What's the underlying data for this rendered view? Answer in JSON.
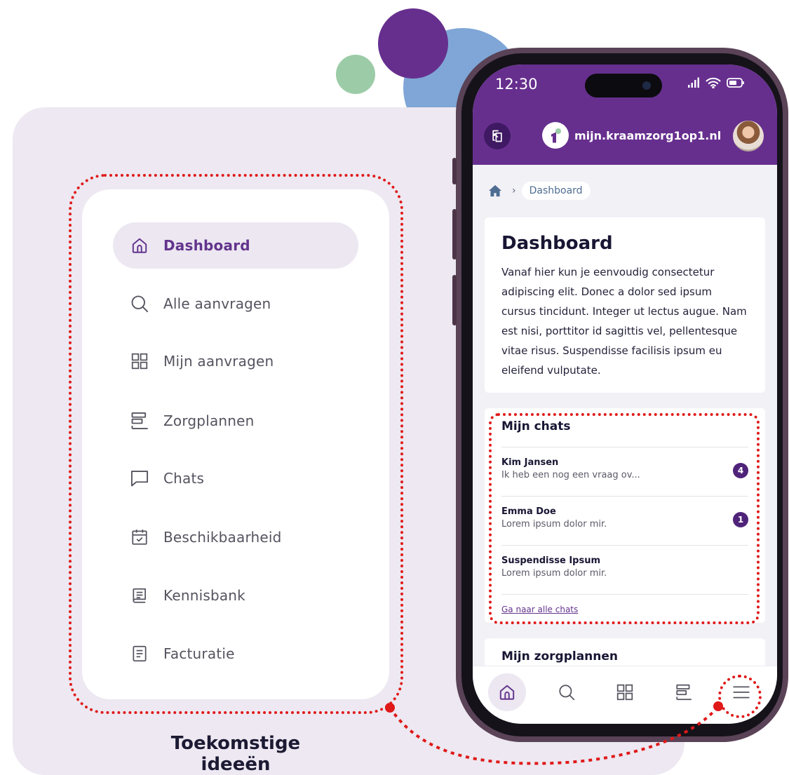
{
  "nav": {
    "items": [
      {
        "label": "Dashboard",
        "icon": "home-icon",
        "active": true
      },
      {
        "label": "Alle aanvragen",
        "icon": "search-icon",
        "active": false
      },
      {
        "label": "Mijn aanvragen",
        "icon": "grid-icon",
        "active": false
      },
      {
        "label": "Zorgplannen",
        "icon": "list-icon",
        "active": false
      },
      {
        "label": "Chats",
        "icon": "chat-icon",
        "active": false
      },
      {
        "label": "Beschikbaarheid",
        "icon": "calendar-check-icon",
        "active": false
      },
      {
        "label": "Kennisbank",
        "icon": "book-icon",
        "active": false
      },
      {
        "label": "Facturatie",
        "icon": "document-icon",
        "active": false
      }
    ]
  },
  "caption": "Toekomstige ideeën",
  "phone": {
    "time": "12:30",
    "domain": "mijn.kraamzorg1op1.nl",
    "breadcrumb": {
      "current": "Dashboard"
    },
    "dashboard": {
      "title": "Dashboard",
      "text": "Vanaf hier kun je eenvoudig consectetur adipiscing elit. Donec a dolor sed ipsum cursus tincidunt. Integer ut lectus augue. Nam est nisi, porttitor id sagittis vel, pellentesque vitae risus. Suspendisse facilisis ipsum eu eleifend vulputate."
    },
    "chats": {
      "title": "Mijn chats",
      "items": [
        {
          "name": "Kim Jansen",
          "preview": "Ik heb een nog een vraag ov...",
          "unread": "4"
        },
        {
          "name": "Emma Doe",
          "preview": "Lorem ipsum dolor mir.",
          "unread": "1"
        },
        {
          "name": "Suspendisse Ipsum",
          "preview": "Lorem ipsum dolor mir.",
          "unread": ""
        }
      ],
      "all_link": "Ga naar alle chats"
    },
    "careplans": {
      "title": "Mijn zorgplannen"
    },
    "bottom_nav": [
      "home-icon",
      "search-icon",
      "grid-icon",
      "list-icon",
      "menu-icon"
    ]
  },
  "colors": {
    "brand_purple": "#662f8e",
    "panel": "#ede8f1",
    "annotation_red": "#e01919",
    "badge": "#4f2379"
  }
}
